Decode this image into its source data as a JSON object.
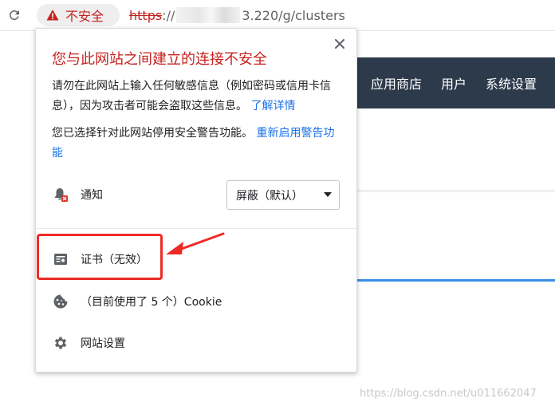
{
  "address_bar": {
    "security_chip_text": "不安全",
    "url_scheme": "https",
    "url_separator": "://",
    "url_host_visible": "3.220",
    "url_path": "/g/clusters"
  },
  "background_page": {
    "nav_items": [
      "应用商店",
      "用户",
      "系统设置"
    ]
  },
  "popup": {
    "title": "您与此网站之间建立的连接不安全",
    "description": "请勿在此网站上输入任何敏感信息（例如密码或信用卡信息），因为攻击者可能会盗取这些信息。",
    "learn_more_link": "了解详情",
    "warning_disabled_text": "您已选择针对此网站停用安全警告功能。",
    "reenable_link": "重新启用警告功能",
    "notification": {
      "label": "通知",
      "select_value": "屏蔽（默认）"
    },
    "certificate_label": "证书（无效）",
    "cookie_label": "（目前使用了 5 个）Cookie",
    "site_settings_label": "网站设置"
  },
  "watermark": "https://blog.csdn.net/u011662047",
  "colors": {
    "danger": "#c5221f",
    "link": "#1a73e8",
    "nav_background": "#2d3a4b",
    "annotation": "#ee2a24"
  }
}
